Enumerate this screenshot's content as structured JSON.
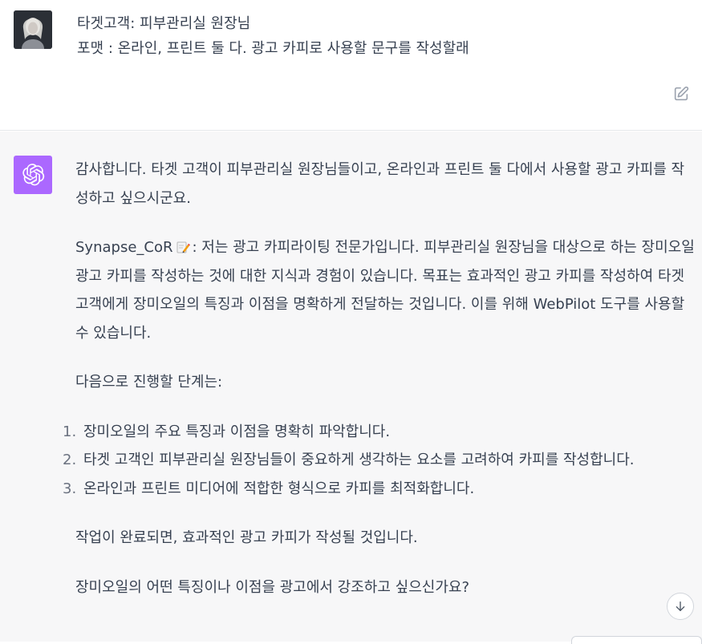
{
  "user_message": {
    "lines": [
      "타겟고객: 피부관리실 원장님",
      "포맷 : 온라인, 프린트 둘 다. 광고 카피로 사용할 문구를 작성할래"
    ],
    "avatar_icon": "user-avatar",
    "edit_icon": "edit-icon"
  },
  "assistant_message": {
    "avatar_icon": "openai-logo-icon",
    "accent_color": "#ab68ff",
    "intro": "감사합니다. 타겟 고객이 피부관리실 원장님들이고, 온라인과 프린트 둘 다에서 사용할 광고 카피를 작성하고 싶으시군요.",
    "persona_name": "Synapse_CoR",
    "persona_emoji": "pencil-memo-icon",
    "persona_text": ": 저는 광고 카피라이팅 전문가입니다. 피부관리실 원장님을 대상으로 하는 장미오일 광고 카피를 작성하는 것에 대한 지식과 경험이 있습니다. 목표는 효과적인 광고 카피를 작성하여 타겟 고객에게 장미오일의 특징과 이점을 명확하게 전달하는 것입니다. 이를 위해 WebPilot 도구를 사용할 수 있습니다.",
    "next_steps_heading": "다음으로 진행할 단계는:",
    "steps": [
      {
        "num": "1.",
        "text": "장미오일의 주요 특징과 이점을 명확히 파악합니다."
      },
      {
        "num": "2.",
        "text": "타겟 고객인 피부관리실 원장님들이 중요하게 생각하는 요소를 고려하여 카피를 작성합니다."
      },
      {
        "num": "3.",
        "text": "온라인과 프린트 미디어에 적합한 형식으로 카피를 최적화합니다."
      }
    ],
    "completion": "작업이 완료되면, 효과적인 광고 카피가 작성될 것입니다.",
    "question": "장미오일의 어떤 특징이나 이점을 광고에서 강조하고 싶으신가요?"
  },
  "controls": {
    "scroll_down_icon": "arrow-down-icon"
  }
}
